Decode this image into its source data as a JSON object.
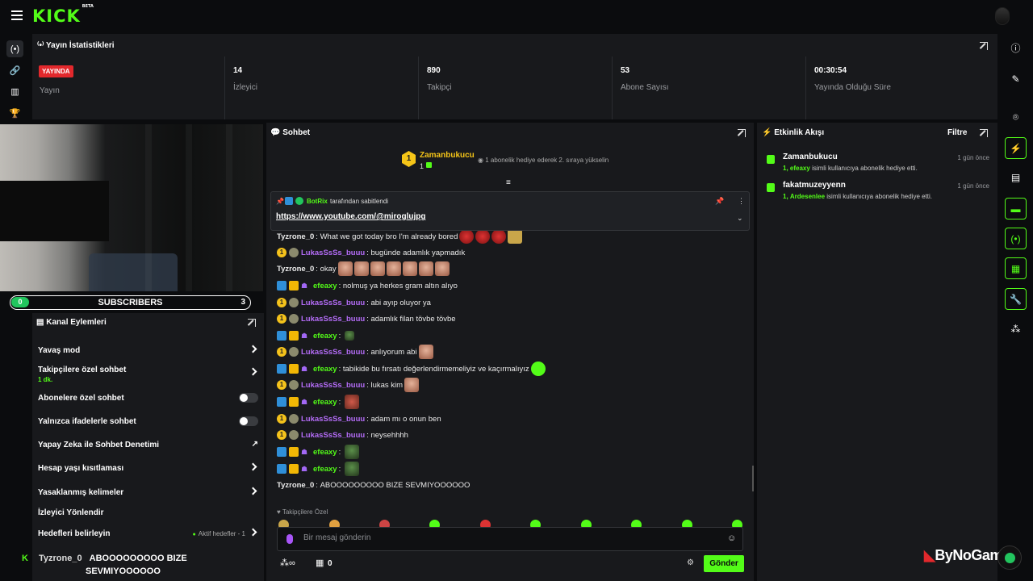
{
  "app": {
    "logo": "KICK",
    "logo_sup": "BETA"
  },
  "stats": {
    "title": "Yayın İstatistikleri",
    "live_badge": "YAYINDA",
    "items": [
      {
        "value": "",
        "label": "Yayın"
      },
      {
        "value": "14",
        "label": "İzleyici"
      },
      {
        "value": "890",
        "label": "Takipçi"
      },
      {
        "value": "53",
        "label": "Abone Sayısı"
      },
      {
        "value": "00:30:54",
        "label": "Yayında Olduğu Süre"
      }
    ]
  },
  "subscribers_bar": {
    "left": "0",
    "title": "SUBSCRIBERS",
    "count": "3",
    "accent": "#22c55e"
  },
  "channel_actions": {
    "title": "Kanal Eylemleri",
    "items": [
      {
        "label": "Yavaş mod"
      },
      {
        "label": "Takipçilere özel sohbet",
        "sub": "1 dk."
      },
      {
        "label": "Abonelere özel sohbet"
      },
      {
        "label": "Yalnızca ifadelerle sohbet"
      },
      {
        "label": "Yapay Zeka ile Sohbet Denetimi"
      },
      {
        "label": "Hesap yaşı kısıtlaması"
      },
      {
        "label": "Yasaklanmış kelimeler"
      },
      {
        "label": "İzleyici Yönlendir"
      },
      {
        "label": "Hedefleri belirleyin",
        "meta": "Aktif hedefler - 1"
      }
    ]
  },
  "ticker": {
    "user": "Tyzrone_0",
    "line1": "ABOOOOOOOOO BIZE",
    "line2": "SEVMIYOOOOOO"
  },
  "chat": {
    "title": "Sohbet",
    "top_gifter": {
      "rank": "1",
      "name": "Zamanbukucu",
      "count": "1",
      "note": "1 abonelik hediye ederek 2. sıraya yükselin"
    },
    "pinned": {
      "by": "BotRix",
      "by_suffix": "tarafından sabitlendi",
      "link": "https://www.youtube.com/@miroglujpg"
    },
    "messages": [
      {
        "user": "Tyzrone_0",
        "text": "What we got today bro I'm already bored"
      },
      {
        "user": "LukasSsSs_buuu",
        "text": "bugünde adamlık yapmadık"
      },
      {
        "user": "Tyzrone_0",
        "text": "okay"
      },
      {
        "user": "efeaxy",
        "text": "nolmuş ya herkes gram altın alıyo"
      },
      {
        "user": "LukasSsSs_buuu",
        "text": "abi ayıp oluyor ya"
      },
      {
        "user": "LukasSsSs_buuu",
        "text": "adamlık filan tövbe tövbe"
      },
      {
        "user": "efeaxy",
        "text": ""
      },
      {
        "user": "LukasSsSs_buuu",
        "text": "anlıyorum abi"
      },
      {
        "user": "efeaxy",
        "text": "tabikide bu fırsatı değerlendirmemeliyiz ve kaçırmalıyız"
      },
      {
        "user": "LukasSsSs_buuu",
        "text": "lukas kim"
      },
      {
        "user": "efeaxy",
        "text": ""
      },
      {
        "user": "LukasSsSs_buuu",
        "text": "adam mı o onun ben"
      },
      {
        "user": "LukasSsSs_buuu",
        "text": "neysehhhh"
      },
      {
        "user": "efeaxy",
        "text": ""
      },
      {
        "user": "efeaxy",
        "text": ""
      },
      {
        "user": "Tyzrone_0",
        "text": "ABOOOOOOOOO BIZE SEVMIYOOOOOO"
      }
    ],
    "followers_only_label": "Takipçilere Özel",
    "input_placeholder": "Bir mesaj gönderin",
    "points": "0",
    "send_label": "Gönder"
  },
  "activity": {
    "title": "Etkinlik Akışı",
    "filter_label": "Filtre",
    "items": [
      {
        "name": "Zamanbukucu",
        "time": "1 gün önce",
        "count": "1,",
        "target": "efeaxy",
        "desc": "isimli kullanıcıya abonelik hediye etti."
      },
      {
        "name": "fakatmuzeyyenn",
        "time": "1 gün önce",
        "count": "1,",
        "target": "Ardesenlee",
        "desc": "isimli kullanıcıya abonelik hediye etti."
      }
    ]
  },
  "watermark": {
    "text": "ByNoGame"
  },
  "colors": {
    "accent": "#53fc18",
    "live": "#e2282c",
    "panel": "#18191c",
    "bg": "#0b0c0e"
  }
}
